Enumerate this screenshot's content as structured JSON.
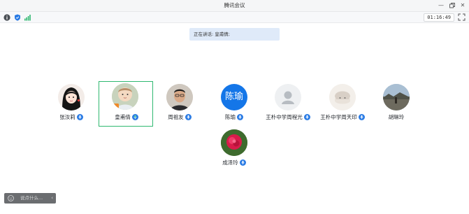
{
  "window": {
    "title": "腾讯会议"
  },
  "toolbar": {
    "timer": "01:16:49"
  },
  "speaking": {
    "text": "正在讲话: 皇甫倩;"
  },
  "participants": [
    {
      "name": "张汝莉",
      "avatar": "cartoon-girl",
      "mic": "on",
      "active": false
    },
    {
      "name": "皇甫倩",
      "avatar": "baby-photo",
      "mic": "on",
      "active": true
    },
    {
      "name": "周祖友",
      "avatar": "man-photo",
      "mic": "on",
      "active": false
    },
    {
      "name": "陈瑜",
      "avatar_text": "陈瑜",
      "avatar": "text-initial",
      "mic": "on",
      "active": false
    },
    {
      "name": "王朴中学周程光",
      "avatar": "default-person",
      "mic": "on",
      "active": false
    },
    {
      "name": "王朴中学周天印",
      "avatar": "character-photo",
      "mic": "on",
      "active": false
    },
    {
      "name": "胡琳玲",
      "avatar": "landscape-photo",
      "mic": "off",
      "active": false
    },
    {
      "name": "成泽玲",
      "avatar": "flower-photo",
      "mic": "on",
      "active": false
    }
  ],
  "chat": {
    "placeholder": "说点什么..."
  },
  "colors": {
    "active_border": "#2fb870",
    "mic_blue": "#2a7be4",
    "speaking_bg": "#dfeaf9",
    "chen_avatar": "#1476e8"
  }
}
